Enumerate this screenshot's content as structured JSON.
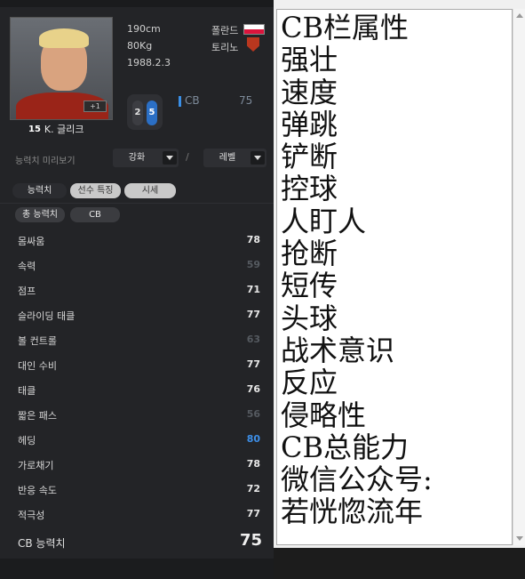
{
  "player": {
    "height": "190cm",
    "weight": "80Kg",
    "birth": "1988.2.3",
    "nation": "폴란드",
    "club": "토리노",
    "number": "15",
    "name": "K. 글리크",
    "photo_badge": "+1",
    "left_foot": "2",
    "right_foot": "5",
    "position": "CB",
    "position_ovr": "75"
  },
  "preview": {
    "label": "능력치 미리보기",
    "enhance": "강화",
    "slash": "/",
    "level": "레벨"
  },
  "tabs": [
    {
      "label": "능력치"
    },
    {
      "label": "선수 특징"
    },
    {
      "label": "시세"
    }
  ],
  "chips": [
    {
      "label": "총 능력치"
    },
    {
      "label": "CB"
    }
  ],
  "stats": [
    {
      "name": "몸싸움",
      "value": "78",
      "style": "normal"
    },
    {
      "name": "속력",
      "value": "59",
      "style": "dim"
    },
    {
      "name": "점프",
      "value": "71",
      "style": "normal"
    },
    {
      "name": "슬라이딩 태클",
      "value": "77",
      "style": "normal"
    },
    {
      "name": "볼 컨트롤",
      "value": "63",
      "style": "dim"
    },
    {
      "name": "대인 수비",
      "value": "77",
      "style": "normal"
    },
    {
      "name": "태클",
      "value": "76",
      "style": "normal"
    },
    {
      "name": "짧은 패스",
      "value": "56",
      "style": "dim"
    },
    {
      "name": "헤딩",
      "value": "80",
      "style": "blue"
    },
    {
      "name": "가로채기",
      "value": "78",
      "style": "normal"
    },
    {
      "name": "반응 속도",
      "value": "72",
      "style": "normal"
    },
    {
      "name": "적극성",
      "value": "77",
      "style": "normal"
    }
  ],
  "cb_total": {
    "label": "CB 능력치",
    "value": "75"
  },
  "notepad": {
    "lines": [
      "CB栏属性",
      "强壮",
      "速度",
      "弹跳",
      "铲断",
      "控球",
      "人盯人",
      "抢断",
      "短传",
      "头球",
      "战术意识",
      "反应",
      "侵略性",
      "CB总能力",
      "微信公众号:",
      "若恍惚流年"
    ]
  },
  "colors": {
    "panel_bg": "#232427",
    "accent_blue": "#3d8fe8",
    "notepad_bg": "#ffffff"
  }
}
